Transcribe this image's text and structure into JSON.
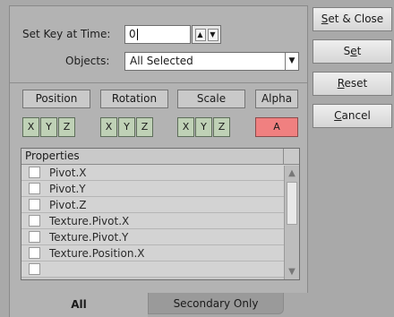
{
  "header": {
    "set_key_label": "Set Key at Time:",
    "time_value": "0",
    "objects_label": "Objects:",
    "objects_value": "All Selected"
  },
  "groups": {
    "position": "Position",
    "rotation": "Rotation",
    "scale": "Scale",
    "alpha": "Alpha"
  },
  "axes": [
    "X",
    "Y",
    "Z"
  ],
  "alpha_axis": "A",
  "properties": {
    "header": "Properties",
    "items": [
      "Pivot.X",
      "Pivot.Y",
      "Pivot.Z",
      "Texture.Pivot.X",
      "Texture.Pivot.Y",
      "Texture.Position.X"
    ]
  },
  "tabs": {
    "all": "All",
    "secondary": "Secondary Only"
  },
  "buttons": {
    "set_close_first": "S",
    "set_close_rest": "et & Close",
    "set_first": "S",
    "set_under": "e",
    "set_rest": "t",
    "reset_first": "R",
    "reset_rest": "eset",
    "cancel_first": "C",
    "cancel_rest": "ancel"
  },
  "colors": {
    "axis_green": "#bfd1b6",
    "alpha_red": "#f08080"
  }
}
